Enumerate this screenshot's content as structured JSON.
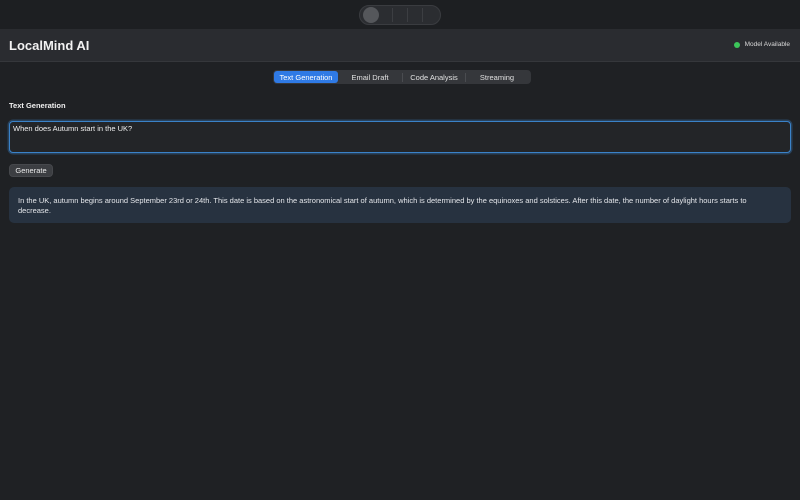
{
  "app": {
    "title": "LocalMind AI"
  },
  "status": {
    "label": "Model Available",
    "color": "#3cc65a"
  },
  "tabs": [
    {
      "label": "Text Generation",
      "active": true
    },
    {
      "label": "Email Draft",
      "active": false
    },
    {
      "label": "Code Analysis",
      "active": false
    },
    {
      "label": "Streaming",
      "active": false
    }
  ],
  "section": {
    "title": "Text Generation"
  },
  "prompt": {
    "value": "When does Autumn start in the UK?"
  },
  "actions": {
    "generate_label": "Generate"
  },
  "response": {
    "text": "In the UK, autumn begins around September 23rd or 24th. This date is based on the astronomical start of autumn, which is determined by the equinoxes and solstices. After this date, the number of daylight hours starts to decrease."
  },
  "colors": {
    "accent": "#2f7ae5",
    "focus_ring": "#3a82c8",
    "response_bg": "#273240"
  }
}
